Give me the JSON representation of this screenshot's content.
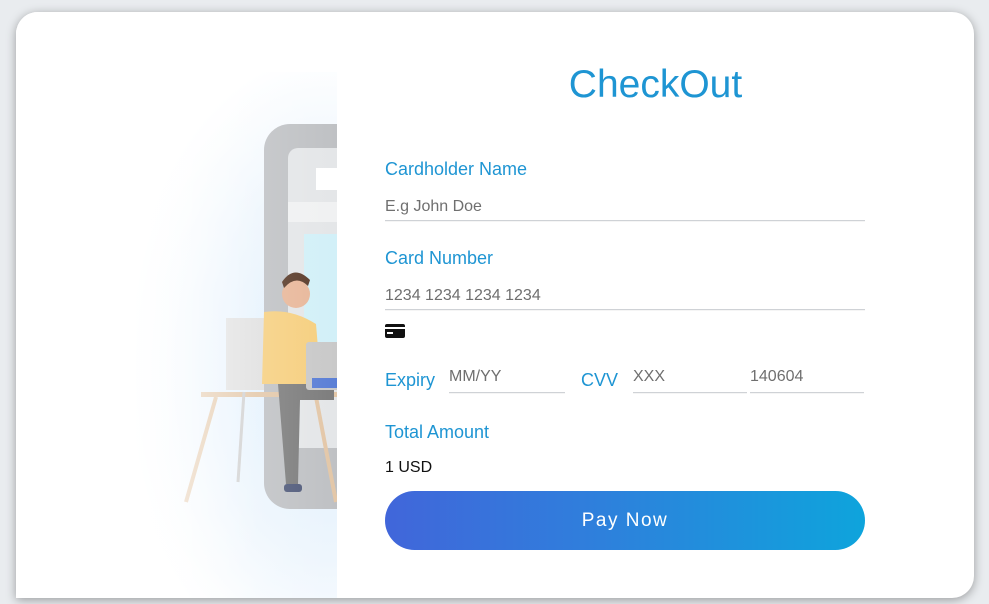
{
  "checkout": {
    "title": "CheckOut",
    "cardholder": {
      "label": "Cardholder Name",
      "placeholder": "E.g John Doe"
    },
    "card_number": {
      "label": "Card Number",
      "placeholder": "1234 1234 1234 1234",
      "icon": "credit-card-icon"
    },
    "expiry": {
      "label": "Expiry",
      "placeholder": "MM/YY"
    },
    "cvv": {
      "label": "CVV",
      "placeholder": "XXX"
    },
    "extra_field": {
      "placeholder": "140604"
    },
    "total": {
      "label": "Total Amount",
      "value": "1 USD"
    },
    "pay_label": "Pay Now"
  },
  "colors": {
    "accent": "#1e95d3",
    "button_gradient_start": "#4166da",
    "button_gradient_end": "#0ea4dc"
  }
}
